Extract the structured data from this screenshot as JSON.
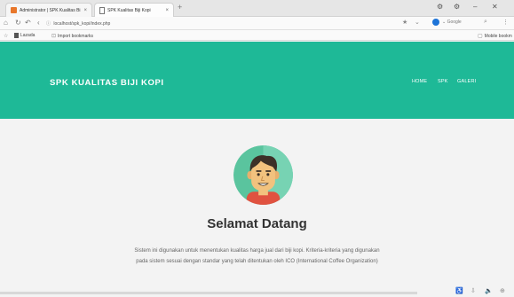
{
  "browser": {
    "tabs": [
      {
        "title": "Administrator | SPK Kualitas Bi...",
        "close": "×"
      },
      {
        "title": "SPK Kualitas Biji Kopi",
        "close": "×"
      }
    ],
    "new_tab": "+",
    "url": "localhost/spk_kopi/index.php",
    "search_engine": "Google",
    "bookmarks": {
      "lazada": "Lazada",
      "import": "Import bookmarks",
      "mobile": "Mobile bookm"
    }
  },
  "navbar": {
    "brand": "SPK KUALITAS BIJI KOPI",
    "menu": [
      "HOME",
      "SPK",
      "GALERI"
    ]
  },
  "main": {
    "heading": "Selamat Datang",
    "description_line1": "Sistem ini digunakan untuk menentukan kualitas harga jual dari biji kopi. Kriteria-kriteria yang digunakan",
    "description_line2": "pada sistem sesuai dengan standar yang telah ditentukan oleh ICO (International Coffee Organization)"
  },
  "colors": {
    "navbar": "#1eb997",
    "avatar_bg": "#5ac49e",
    "skin": "#f2c27e",
    "hair": "#3c3027"
  }
}
